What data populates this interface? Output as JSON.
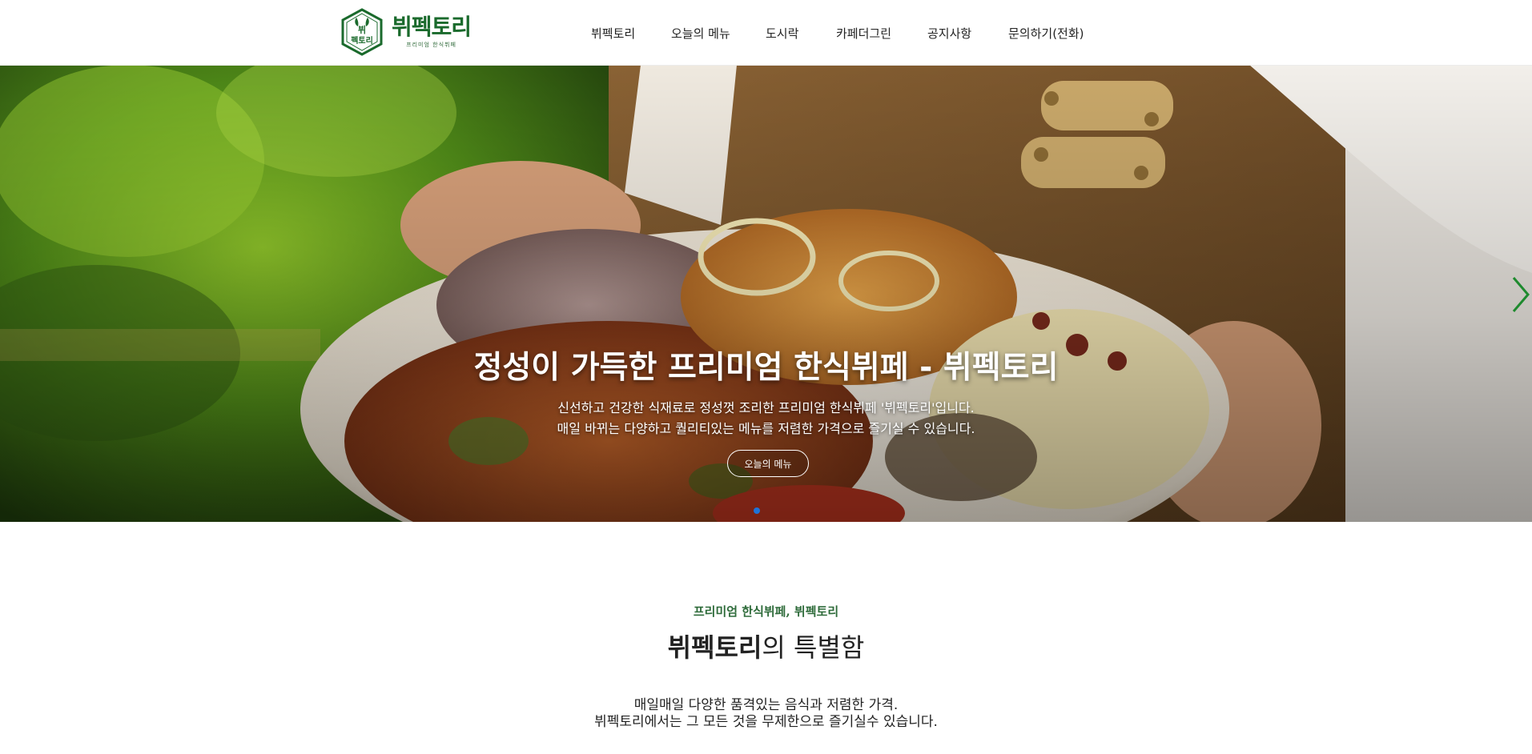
{
  "brand": {
    "emblem_text": "뷔펙토리",
    "name": "뷔펙토리",
    "tagline": "프리미엄 한식뷔페",
    "color": "#1a6a2c"
  },
  "nav": {
    "items": [
      "뷔펙토리",
      "오늘의 메뉴",
      "도시락",
      "카페더그린",
      "공지사항",
      "문의하기(전화)"
    ]
  },
  "hero": {
    "title": "정성이 가득한 프리미엄 한식뷔페 - 뷔펙토리",
    "lines": [
      "신선하고 건강한 식재료로 정성껏 조리한 프리미엄 한식뷔페 '뷔펙토리'입니다.",
      "매일 바뀌는 다양하고 퀄리티있는 메뉴를 저렴한 가격으로 즐기실 수 있습니다."
    ],
    "button_label": "오늘의 메뉴",
    "next_icon": "chevron-right-icon",
    "arrow_color": "#1e8a2e",
    "dot_color": "#1e73d8",
    "slide_count": 1,
    "active_slide": 1
  },
  "intro": {
    "kicker": "프리미엄 한식뷔페, 뷔펙토리",
    "title_bold": "뷔펙토리",
    "title_rest": "의 특별함",
    "desc": [
      "매일매일 다양한 품격있는 음식과 저렴한 가격.",
      "뷔펙토리에서는 그 모든 것을 무제한으로 즐기실수 있습니다."
    ]
  }
}
